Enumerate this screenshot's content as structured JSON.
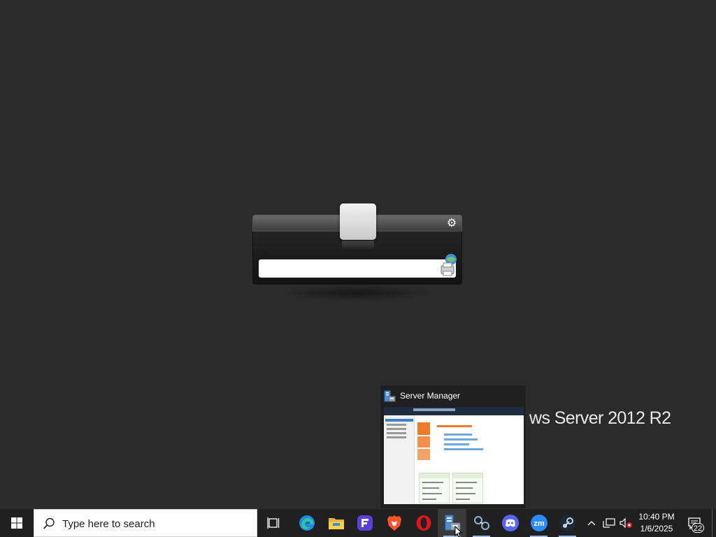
{
  "background_text": "ws Server 2012 R2",
  "thumbnail": {
    "title": "Server Manager"
  },
  "slider": {
    "input_value": ""
  },
  "taskbar": {
    "search_placeholder": "Type here to search",
    "apps": [
      {
        "name": "Task View",
        "icon": "task-view-icon"
      },
      {
        "name": "Microsoft Edge",
        "icon": "edge-icon"
      },
      {
        "name": "File Explorer",
        "icon": "file-explorer-icon"
      },
      {
        "name": "Clipchamp",
        "icon": "app-f-icon"
      },
      {
        "name": "Brave",
        "icon": "brave-icon"
      },
      {
        "name": "Opera",
        "icon": "opera-icon"
      },
      {
        "name": "Server Manager",
        "icon": "server-manager-icon"
      },
      {
        "name": "Network app",
        "icon": "network-icon"
      },
      {
        "name": "Discord",
        "icon": "discord-icon"
      },
      {
        "name": "Zoom",
        "icon": "zoom-icon"
      },
      {
        "name": "Steam",
        "icon": "steam-icon"
      }
    ],
    "clock_time": "10:40 PM",
    "clock_date": "1/6/2025",
    "notification_count": "22"
  },
  "colors": {
    "desktop_bg": "#2b2b2b",
    "taskbar_bg": "#202020",
    "accent": "#ee7b2b"
  }
}
